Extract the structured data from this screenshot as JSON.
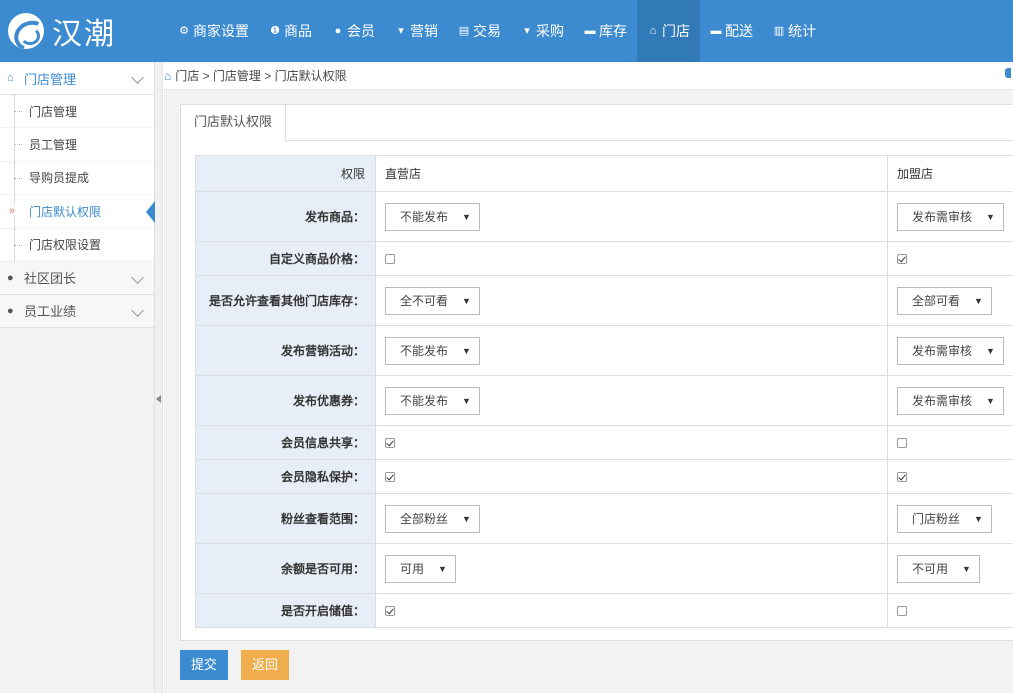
{
  "app": {
    "brand": "汉潮"
  },
  "nav": [
    {
      "label": "商家设置",
      "icon": "gear-icon",
      "glyph": "⚙",
      "active": false
    },
    {
      "label": "商品",
      "icon": "box-icon",
      "glyph": "❶",
      "active": false
    },
    {
      "label": "会员",
      "icon": "user-icon",
      "glyph": "●",
      "active": false
    },
    {
      "label": "营销",
      "icon": "cart-icon",
      "glyph": "▾",
      "active": false
    },
    {
      "label": "交易",
      "icon": "document-icon",
      "glyph": "▤",
      "active": false
    },
    {
      "label": "采购",
      "icon": "cart-icon",
      "glyph": "▾",
      "active": false
    },
    {
      "label": "库存",
      "icon": "storage-icon",
      "glyph": "▬",
      "active": false
    },
    {
      "label": "门店",
      "icon": "home-icon",
      "glyph": "⌂",
      "active": true
    },
    {
      "label": "配送",
      "icon": "truck-icon",
      "glyph": "▬",
      "active": false
    },
    {
      "label": "统计",
      "icon": "bar-chart-icon",
      "glyph": "▥",
      "active": false
    }
  ],
  "sidebar": {
    "groups": [
      {
        "label": "门店管理",
        "icon": "home-icon",
        "open": true,
        "items": [
          "门店管理",
          "员工管理",
          "导购员提成",
          "门店默认权限",
          "门店权限设置"
        ],
        "active_index": 3
      },
      {
        "label": "社区团长",
        "icon": "users-icon",
        "open": false,
        "items": []
      },
      {
        "label": "员工业绩",
        "icon": "users-icon",
        "open": false,
        "items": []
      }
    ]
  },
  "breadcrumb": {
    "parts": [
      "门店",
      "门店管理",
      "门店默认权限"
    ],
    "separator": ">"
  },
  "tab": {
    "label": "门店默认权限"
  },
  "table": {
    "header": {
      "label": "权限",
      "col1": "直营店",
      "col2": "加盟店"
    },
    "rows": [
      {
        "label": "发布商品：",
        "type": "select",
        "col1": "不能发布",
        "col2": "发布需审核"
      },
      {
        "label": "自定义商品价格：",
        "type": "checkbox",
        "col1": false,
        "col2": true
      },
      {
        "label": "是否允许查看其他门店库存：",
        "type": "select",
        "col1": "全不可看",
        "col2": "全部可看"
      },
      {
        "label": "发布营销活动：",
        "type": "select",
        "col1": "不能发布",
        "col2": "发布需审核"
      },
      {
        "label": "发布优惠券：",
        "type": "select",
        "col1": "不能发布",
        "col2": "发布需审核"
      },
      {
        "label": "会员信息共享：",
        "type": "checkbox",
        "col1": true,
        "col2": false
      },
      {
        "label": "会员隐私保护：",
        "type": "checkbox",
        "col1": true,
        "col2": true
      },
      {
        "label": "粉丝查看范围：",
        "type": "select",
        "col1": "全部粉丝",
        "col2": "门店粉丝"
      },
      {
        "label": "余额是否可用：",
        "type": "select",
        "col1": "可用",
        "col2": "不可用"
      },
      {
        "label": "是否开启储值：",
        "type": "checkbox",
        "col1": true,
        "col2": false
      }
    ]
  },
  "buttons": {
    "submit": "提交",
    "back": "返回"
  },
  "colors": {
    "primary": "#3c8ad0",
    "warning": "#f0ad4e",
    "label_bg": "#e7eef7"
  }
}
